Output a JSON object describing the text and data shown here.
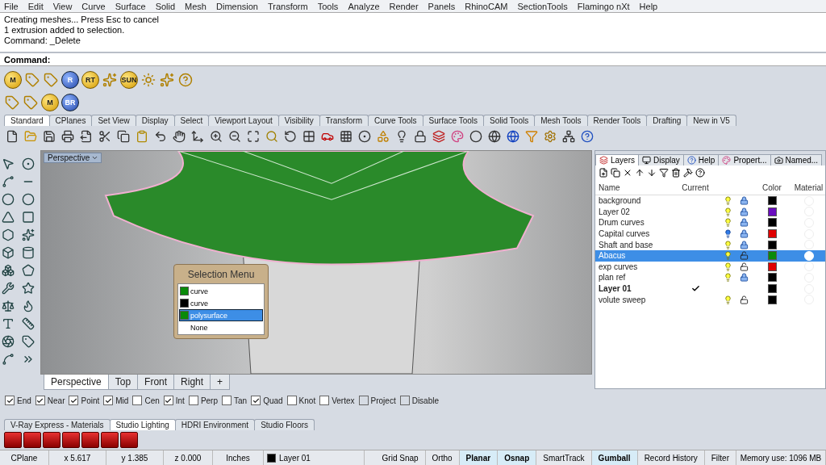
{
  "menu": [
    "File",
    "Edit",
    "View",
    "Curve",
    "Surface",
    "Solid",
    "Mesh",
    "Dimension",
    "Transform",
    "Tools",
    "Analyze",
    "Render",
    "Panels",
    "RhinoCAM",
    "SectionTools",
    "Flamingo nXt",
    "Help"
  ],
  "command_history": [
    "Creating meshes... Press Esc to cancel",
    "1 extrusion added to selection.",
    "Command: _Delete"
  ],
  "command_prompt": "Command:",
  "plugin_toolbar_1": [
    {
      "kind": "letter",
      "text": "M"
    },
    {
      "kind": "icon"
    },
    {
      "kind": "icon"
    },
    {
      "kind": "letter",
      "text": "R"
    },
    {
      "kind": "letter",
      "text": "RT"
    },
    {
      "kind": "icon"
    },
    {
      "kind": "letter",
      "text": "SUN"
    },
    {
      "kind": "icon"
    },
    {
      "kind": "icon"
    },
    {
      "kind": "icon"
    }
  ],
  "plugin_toolbar_2": [
    {
      "kind": "icon"
    },
    {
      "kind": "icon"
    },
    {
      "kind": "letter",
      "text": "M"
    },
    {
      "kind": "letter",
      "text": "BR"
    }
  ],
  "toolbar_tabs": [
    {
      "label": "Standard",
      "selected": true
    },
    {
      "label": "CPlanes",
      "selected": false
    },
    {
      "label": "Set View",
      "selected": false
    },
    {
      "label": "Display",
      "selected": false
    },
    {
      "label": "Select",
      "selected": false
    },
    {
      "label": "Viewport Layout",
      "selected": false
    },
    {
      "label": "Visibility",
      "selected": false
    },
    {
      "label": "Transform",
      "selected": false
    },
    {
      "label": "Curve Tools",
      "selected": false
    },
    {
      "label": "Surface Tools",
      "selected": false
    },
    {
      "label": "Solid Tools",
      "selected": false
    },
    {
      "label": "Mesh Tools",
      "selected": false
    },
    {
      "label": "Render Tools",
      "selected": false
    },
    {
      "label": "Drafting",
      "selected": false
    },
    {
      "label": "New in V5",
      "selected": false
    }
  ],
  "viewport": {
    "title": "Perspective",
    "selection_menu": {
      "title": "Selection Menu",
      "items": [
        {
          "label": "curve",
          "color": "#0a8a0a",
          "selected": false
        },
        {
          "label": "curve",
          "color": "#000000",
          "selected": false
        },
        {
          "label": "polysurface",
          "color": "#0a8a0a",
          "selected": true
        },
        {
          "label": "None",
          "selected": false
        }
      ]
    }
  },
  "viewport_tabs": [
    {
      "label": "Perspective",
      "selected": true
    },
    {
      "label": "Top",
      "selected": false
    },
    {
      "label": "Front",
      "selected": false
    },
    {
      "label": "Right",
      "selected": false
    },
    {
      "label": "+",
      "selected": false
    }
  ],
  "panel_tabs": [
    {
      "label": "Layers",
      "selected": true
    },
    {
      "label": "Display",
      "selected": false
    },
    {
      "label": "Help",
      "selected": false
    },
    {
      "label": "Propert...",
      "selected": false
    },
    {
      "label": "Named...",
      "selected": false
    }
  ],
  "layers": {
    "columns": [
      "Name",
      "Current",
      "Color",
      "Material"
    ],
    "rows": [
      {
        "name": "background",
        "current": false,
        "visible": true,
        "locked": true,
        "color": "#000000",
        "selected": false
      },
      {
        "name": "Layer 02",
        "current": false,
        "visible": true,
        "locked": true,
        "color": "#6a0dbf",
        "selected": false
      },
      {
        "name": "Drum curves",
        "current": false,
        "visible": true,
        "locked": true,
        "color": "#000000",
        "selected": false
      },
      {
        "name": "Capital curves",
        "current": false,
        "visible": false,
        "locked": true,
        "color": "#e00000",
        "selected": false
      },
      {
        "name": "Shaft and base",
        "current": false,
        "visible": true,
        "locked": true,
        "color": "#000000",
        "selected": false
      },
      {
        "name": "Abacus",
        "current": false,
        "visible": true,
        "locked": false,
        "color": "#0a8a0a",
        "selected": true
      },
      {
        "name": "exp curves",
        "current": false,
        "visible": true,
        "locked": false,
        "color": "#e00000",
        "selected": false
      },
      {
        "name": "plan ref",
        "current": false,
        "visible": true,
        "locked": true,
        "color": "#000000",
        "selected": false
      },
      {
        "name": "Layer 01",
        "current": true,
        "color": "#000000",
        "selected": false
      },
      {
        "name": "volute sweep",
        "current": false,
        "visible": true,
        "locked": false,
        "color": "#000000",
        "selected": false
      }
    ]
  },
  "osnaps": [
    {
      "label": "End",
      "checked": true,
      "disabled": false
    },
    {
      "label": "Near",
      "checked": true,
      "disabled": false
    },
    {
      "label": "Point",
      "checked": true,
      "disabled": false
    },
    {
      "label": "Mid",
      "checked": true,
      "disabled": false
    },
    {
      "label": "Cen",
      "checked": false,
      "disabled": false
    },
    {
      "label": "Int",
      "checked": true,
      "disabled": false
    },
    {
      "label": "Perp",
      "checked": false,
      "disabled": false
    },
    {
      "label": "Tan",
      "checked": false,
      "disabled": false
    },
    {
      "label": "Quad",
      "checked": true,
      "disabled": false
    },
    {
      "label": "Knot",
      "checked": false,
      "disabled": false
    },
    {
      "label": "Vertex",
      "checked": false,
      "disabled": false
    },
    {
      "label": "Project",
      "checked": false,
      "disabled": true
    },
    {
      "label": "Disable",
      "checked": false,
      "disabled": true
    }
  ],
  "render_tabs": [
    {
      "label": "V-Ray Express - Materials",
      "selected": false
    },
    {
      "label": "Studio Lighting",
      "selected": true
    },
    {
      "label": "HDRI Environment",
      "selected": false
    },
    {
      "label": "Studio Floors",
      "selected": false
    }
  ],
  "status_bar": {
    "cplane": "CPlane",
    "x": "x 5.617",
    "y": "y 1.385",
    "z": "z 0.000",
    "units": "Inches",
    "layer": {
      "name": "Layer 01",
      "color": "#000000"
    },
    "toggles": [
      {
        "label": "Grid Snap",
        "on": false
      },
      {
        "label": "Ortho",
        "on": false
      },
      {
        "label": "Planar",
        "on": true
      },
      {
        "label": "Osnap",
        "on": true
      },
      {
        "label": "SmartTrack",
        "on": false
      },
      {
        "label": "Gumball",
        "on": true
      },
      {
        "label": "Record History",
        "on": false
      },
      {
        "label": "Filter",
        "on": false
      }
    ],
    "memory": "Memory use: 1096 MB"
  }
}
